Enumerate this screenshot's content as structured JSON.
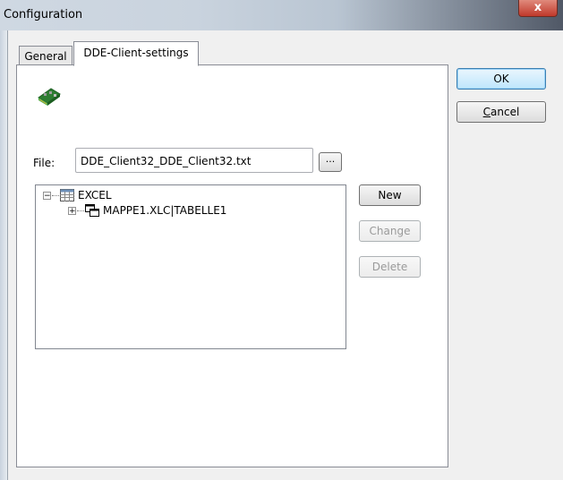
{
  "window": {
    "title": "Configuration",
    "close_label": "x"
  },
  "tabs": [
    {
      "label": "General"
    },
    {
      "label": "DDE-Client-settings"
    }
  ],
  "file": {
    "label": "File:",
    "value": "DDE_Client32_DDE_Client32.txt",
    "browse_label": "..."
  },
  "tree": {
    "items": [
      {
        "label": "EXCEL",
        "expander": "⊟",
        "icon": "table-icon"
      },
      {
        "label": "MAPPE1.XLC|TABELLE1",
        "expander": "+",
        "icon": "windows-icon"
      }
    ]
  },
  "buttons": {
    "new": "New",
    "change": "Change",
    "delete": "Delete",
    "ok": "OK",
    "cancel_prefix": "C",
    "cancel_rest": "ancel"
  },
  "colors": {
    "accent": "#3c7fb1",
    "background": "#f0f0f0"
  }
}
